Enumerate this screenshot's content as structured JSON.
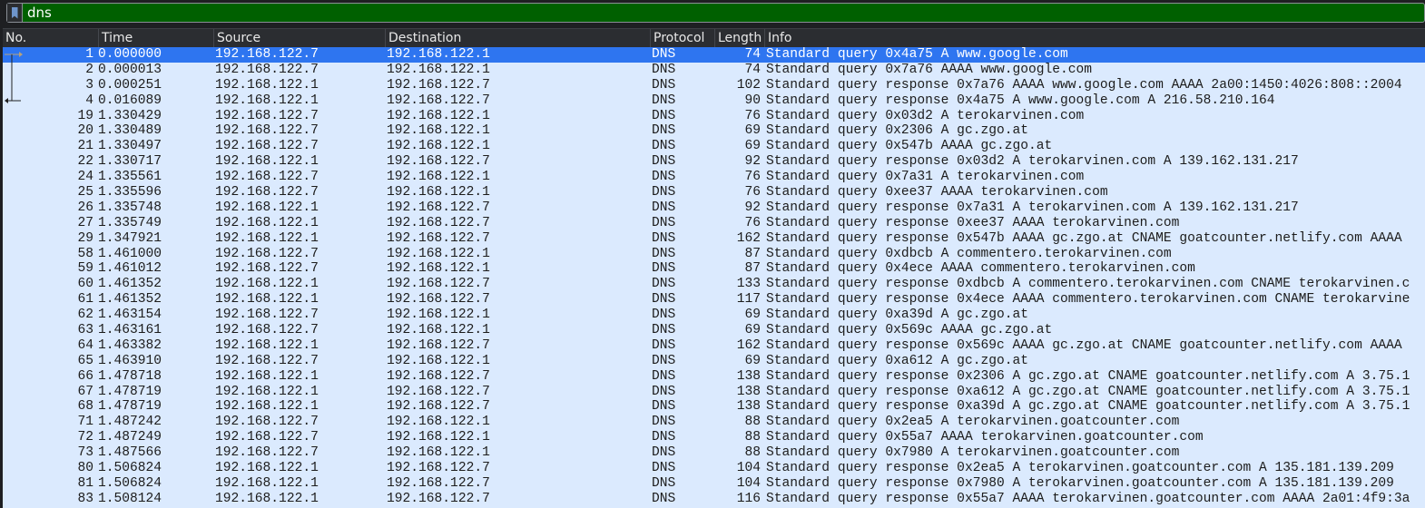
{
  "filter": {
    "value": "dns",
    "bookmark_icon": "bookmark-icon",
    "valid_color": "#006000"
  },
  "columns": [
    "No.",
    "Time",
    "Source",
    "Destination",
    "Protocol",
    "Length",
    "Info"
  ],
  "selected_index": 0,
  "selected_color": "#2e75f0",
  "packets": [
    [
      "1",
      "0.000000",
      "192.168.122.7",
      "192.168.122.1",
      "DNS",
      "74",
      "Standard query 0x4a75 A www.google.com"
    ],
    [
      "2",
      "0.000013",
      "192.168.122.7",
      "192.168.122.1",
      "DNS",
      "74",
      "Standard query 0x7a76 AAAA www.google.com"
    ],
    [
      "3",
      "0.000251",
      "192.168.122.1",
      "192.168.122.7",
      "DNS",
      "102",
      "Standard query response 0x7a76 AAAA www.google.com AAAA 2a00:1450:4026:808::2004"
    ],
    [
      "4",
      "0.016089",
      "192.168.122.1",
      "192.168.122.7",
      "DNS",
      "90",
      "Standard query response 0x4a75 A www.google.com A 216.58.210.164"
    ],
    [
      "19",
      "1.330429",
      "192.168.122.7",
      "192.168.122.1",
      "DNS",
      "76",
      "Standard query 0x03d2 A terokarvinen.com"
    ],
    [
      "20",
      "1.330489",
      "192.168.122.7",
      "192.168.122.1",
      "DNS",
      "69",
      "Standard query 0x2306 A gc.zgo.at"
    ],
    [
      "21",
      "1.330497",
      "192.168.122.7",
      "192.168.122.1",
      "DNS",
      "69",
      "Standard query 0x547b AAAA gc.zgo.at"
    ],
    [
      "22",
      "1.330717",
      "192.168.122.1",
      "192.168.122.7",
      "DNS",
      "92",
      "Standard query response 0x03d2 A terokarvinen.com A 139.162.131.217"
    ],
    [
      "24",
      "1.335561",
      "192.168.122.7",
      "192.168.122.1",
      "DNS",
      "76",
      "Standard query 0x7a31 A terokarvinen.com"
    ],
    [
      "25",
      "1.335596",
      "192.168.122.7",
      "192.168.122.1",
      "DNS",
      "76",
      "Standard query 0xee37 AAAA terokarvinen.com"
    ],
    [
      "26",
      "1.335748",
      "192.168.122.1",
      "192.168.122.7",
      "DNS",
      "92",
      "Standard query response 0x7a31 A terokarvinen.com A 139.162.131.217"
    ],
    [
      "27",
      "1.335749",
      "192.168.122.1",
      "192.168.122.7",
      "DNS",
      "76",
      "Standard query response 0xee37 AAAA terokarvinen.com"
    ],
    [
      "29",
      "1.347921",
      "192.168.122.1",
      "192.168.122.7",
      "DNS",
      "162",
      "Standard query response 0x547b AAAA gc.zgo.at CNAME goatcounter.netlify.com AAAA"
    ],
    [
      "58",
      "1.461000",
      "192.168.122.7",
      "192.168.122.1",
      "DNS",
      "87",
      "Standard query 0xdbcb A commentero.terokarvinen.com"
    ],
    [
      "59",
      "1.461012",
      "192.168.122.7",
      "192.168.122.1",
      "DNS",
      "87",
      "Standard query 0x4ece AAAA commentero.terokarvinen.com"
    ],
    [
      "60",
      "1.461352",
      "192.168.122.1",
      "192.168.122.7",
      "DNS",
      "133",
      "Standard query response 0xdbcb A commentero.terokarvinen.com CNAME terokarvinen.c"
    ],
    [
      "61",
      "1.461352",
      "192.168.122.1",
      "192.168.122.7",
      "DNS",
      "117",
      "Standard query response 0x4ece AAAA commentero.terokarvinen.com CNAME terokarvine"
    ],
    [
      "62",
      "1.463154",
      "192.168.122.7",
      "192.168.122.1",
      "DNS",
      "69",
      "Standard query 0xa39d A gc.zgo.at"
    ],
    [
      "63",
      "1.463161",
      "192.168.122.7",
      "192.168.122.1",
      "DNS",
      "69",
      "Standard query 0x569c AAAA gc.zgo.at"
    ],
    [
      "64",
      "1.463382",
      "192.168.122.1",
      "192.168.122.7",
      "DNS",
      "162",
      "Standard query response 0x569c AAAA gc.zgo.at CNAME goatcounter.netlify.com AAAA"
    ],
    [
      "65",
      "1.463910",
      "192.168.122.7",
      "192.168.122.1",
      "DNS",
      "69",
      "Standard query 0xa612 A gc.zgo.at"
    ],
    [
      "66",
      "1.478718",
      "192.168.122.1",
      "192.168.122.7",
      "DNS",
      "138",
      "Standard query response 0x2306 A gc.zgo.at CNAME goatcounter.netlify.com A 3.75.1"
    ],
    [
      "67",
      "1.478719",
      "192.168.122.1",
      "192.168.122.7",
      "DNS",
      "138",
      "Standard query response 0xa612 A gc.zgo.at CNAME goatcounter.netlify.com A 3.75.1"
    ],
    [
      "68",
      "1.478719",
      "192.168.122.1",
      "192.168.122.7",
      "DNS",
      "138",
      "Standard query response 0xa39d A gc.zgo.at CNAME goatcounter.netlify.com A 3.75.1"
    ],
    [
      "71",
      "1.487242",
      "192.168.122.7",
      "192.168.122.1",
      "DNS",
      "88",
      "Standard query 0x2ea5 A terokarvinen.goatcounter.com"
    ],
    [
      "72",
      "1.487249",
      "192.168.122.7",
      "192.168.122.1",
      "DNS",
      "88",
      "Standard query 0x55a7 AAAA terokarvinen.goatcounter.com"
    ],
    [
      "73",
      "1.487566",
      "192.168.122.7",
      "192.168.122.1",
      "DNS",
      "88",
      "Standard query 0x7980 A terokarvinen.goatcounter.com"
    ],
    [
      "80",
      "1.506824",
      "192.168.122.1",
      "192.168.122.7",
      "DNS",
      "104",
      "Standard query response 0x2ea5 A terokarvinen.goatcounter.com A 135.181.139.209"
    ],
    [
      "81",
      "1.506824",
      "192.168.122.1",
      "192.168.122.7",
      "DNS",
      "104",
      "Standard query response 0x7980 A terokarvinen.goatcounter.com A 135.181.139.209"
    ],
    [
      "83",
      "1.508124",
      "192.168.122.1",
      "192.168.122.7",
      "DNS",
      "116",
      "Standard query response 0x55a7 AAAA terokarvinen.goatcounter.com AAAA 2a01:4f9:3a"
    ]
  ]
}
